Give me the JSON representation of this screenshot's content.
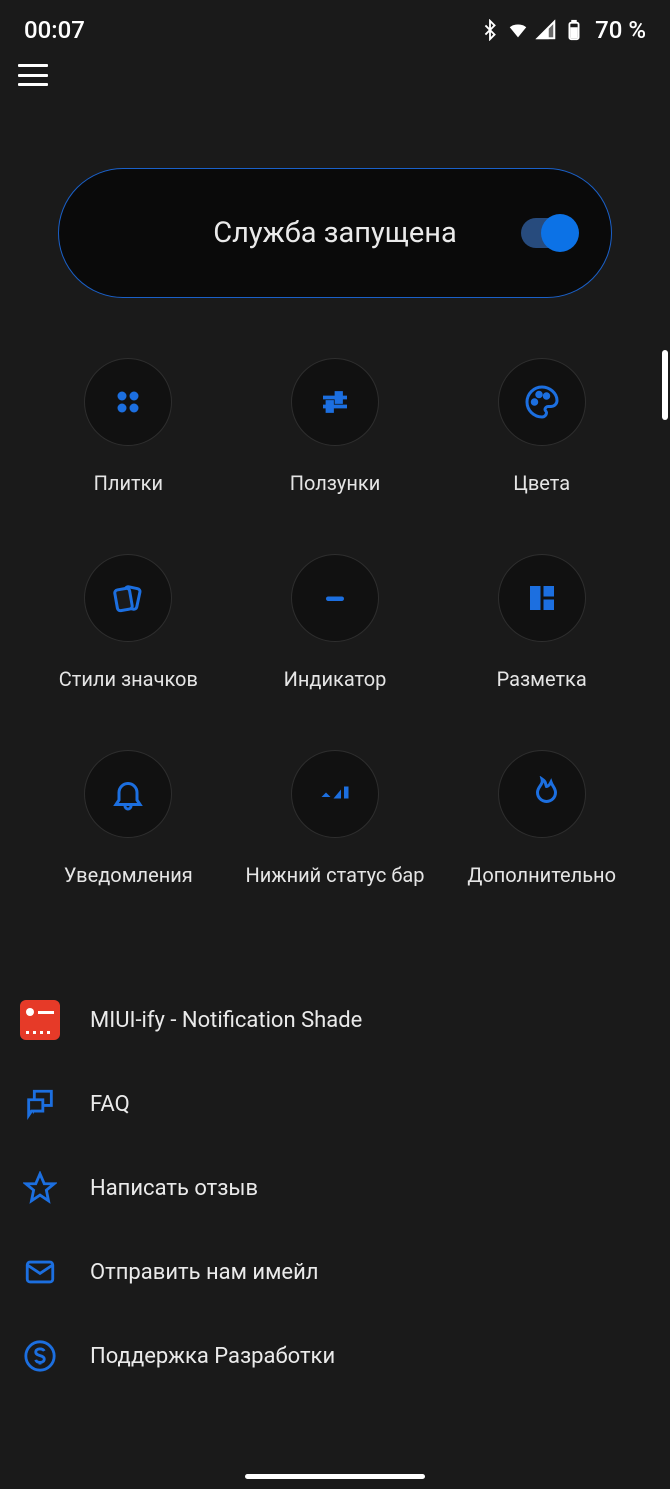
{
  "status": {
    "time": "00:07",
    "battery": "70 %"
  },
  "service": {
    "label": "Служба запущена",
    "enabled": true
  },
  "grid": [
    {
      "icon": "tiles-icon",
      "label": "Плитки"
    },
    {
      "icon": "sliders-icon",
      "label": "Ползунки"
    },
    {
      "icon": "palette-icon",
      "label": "Цвета"
    },
    {
      "icon": "icon-styles-icon",
      "label": "Стили значков"
    },
    {
      "icon": "indicator-icon",
      "label": "Индикатор"
    },
    {
      "icon": "layout-icon",
      "label": "Разметка"
    },
    {
      "icon": "bell-icon",
      "label": "Уведомления"
    },
    {
      "icon": "statusbar-icon",
      "label": "Нижний статус бар"
    },
    {
      "icon": "fire-icon",
      "label": "Дополнительно"
    }
  ],
  "list": [
    {
      "icon": "app-icon",
      "label": "MIUI-ify - Notification Shade"
    },
    {
      "icon": "faq-icon",
      "label": "FAQ"
    },
    {
      "icon": "star-icon",
      "label": "Написать отзыв"
    },
    {
      "icon": "mail-icon",
      "label": "Отправить нам имейл"
    },
    {
      "icon": "dollar-icon",
      "label": "Поддержка Разработки"
    }
  ],
  "colors": {
    "accent": "#1c6fe0",
    "bg": "#1a1a1a"
  }
}
